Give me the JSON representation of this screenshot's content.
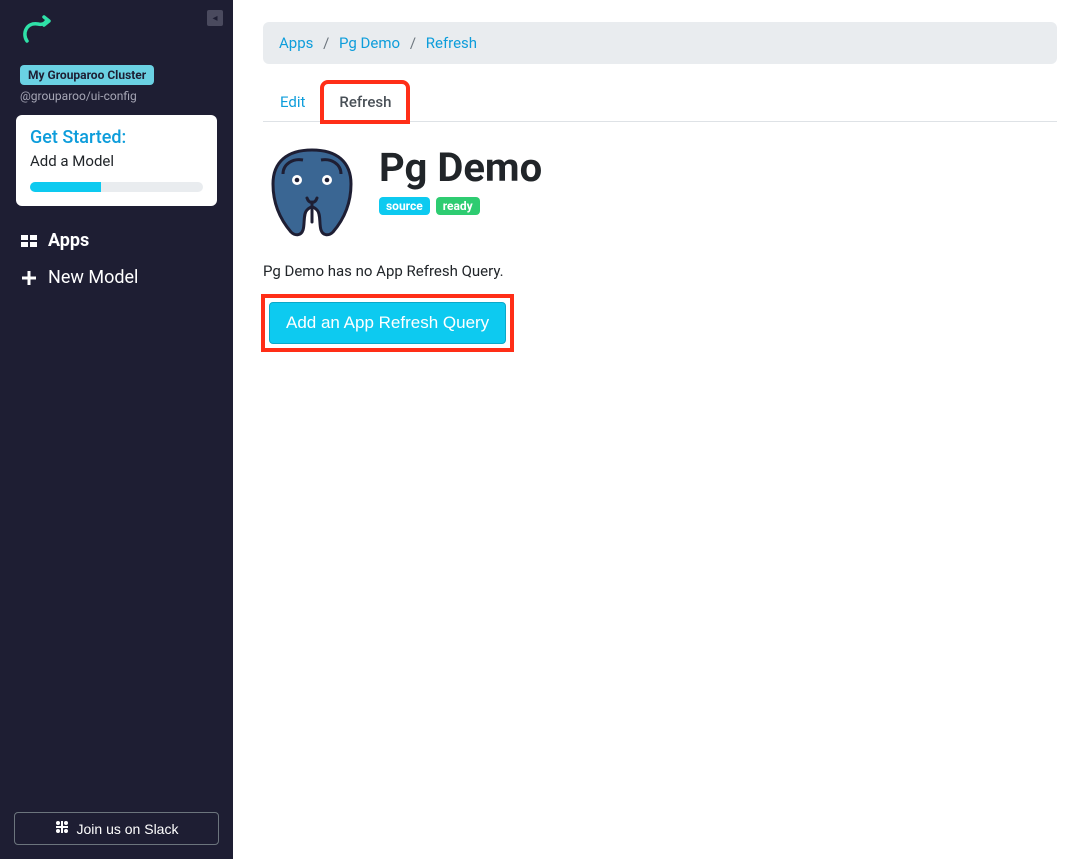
{
  "sidebar": {
    "cluster_badge": "My Grouparoo Cluster",
    "cluster_sub": "@grouparoo/ui-config",
    "get_started": {
      "title": "Get Started:",
      "subtitle": "Add a Model",
      "progress_pct": 41
    },
    "nav": [
      {
        "icon": "grid-icon",
        "label": "Apps",
        "active": true
      },
      {
        "icon": "plus-icon",
        "label": "New Model",
        "active": false
      }
    ],
    "slack_label": "Join us on Slack"
  },
  "breadcrumb": [
    {
      "label": "Apps",
      "link": true
    },
    {
      "label": "Pg Demo",
      "link": true
    },
    {
      "label": "Refresh",
      "link": true
    }
  ],
  "tabs": [
    {
      "label": "Edit",
      "active": false,
      "highlight": false
    },
    {
      "label": "Refresh",
      "active": true,
      "highlight": true
    }
  ],
  "app": {
    "title": "Pg Demo",
    "badges": [
      {
        "text": "source",
        "class": "source"
      },
      {
        "text": "ready",
        "class": "ready"
      }
    ],
    "no_query_text": "Pg Demo has no App Refresh Query.",
    "add_button": "Add an App Refresh Query"
  }
}
